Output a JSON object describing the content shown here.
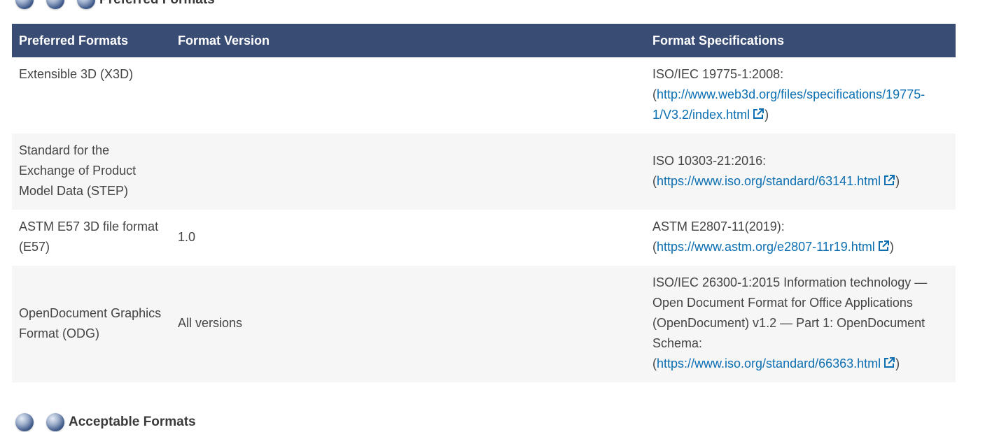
{
  "sections": {
    "preferred_heading": "Preferred Formats",
    "acceptable_heading": "Acceptable Formats"
  },
  "table": {
    "headers": {
      "format": "Preferred Formats",
      "version": "Format Version",
      "spec": "Format Specifications"
    },
    "rows": [
      {
        "format": "Extensible 3D (X3D)",
        "version": "",
        "spec_text": "ISO/IEC 19775-1:2008:",
        "spec_prefix": "(",
        "link": "http://www.web3d.org/files/specifications/19775-1/V3.2/index.html",
        "spec_suffix": ")"
      },
      {
        "format": "Standard for the Exchange of Product Model Data (STEP)",
        "version": "",
        "spec_text": "ISO 10303-21:2016:",
        "spec_prefix": "(",
        "link": "https://www.iso.org/standard/63141.html",
        "spec_suffix": ")"
      },
      {
        "format": "ASTM E57 3D file format (E57)",
        "version": "1.0",
        "spec_text": "ASTM E2807-11(2019):",
        "spec_prefix": "(",
        "link": "https://www.astm.org/e2807-11r19.html",
        "spec_suffix": ")"
      },
      {
        "format": "OpenDocument Graphics Format (ODG)",
        "version": "All versions",
        "spec_text": "ISO/IEC 26300-1:2015 Information technology — Open Document Format for Office Applications (OpenDocument) v1.2 — Part 1: OpenDocument Schema:",
        "spec_prefix": "(",
        "link": "https://www.iso.org/standard/66363.html",
        "spec_suffix": ")"
      }
    ]
  },
  "icons": {
    "external_link": "external-link-icon",
    "section_bullet": "sphere-bullet-icon"
  },
  "colors": {
    "header_bg": "#394d74",
    "link": "#0b6fb2",
    "stripe": "#f6f6f6"
  }
}
